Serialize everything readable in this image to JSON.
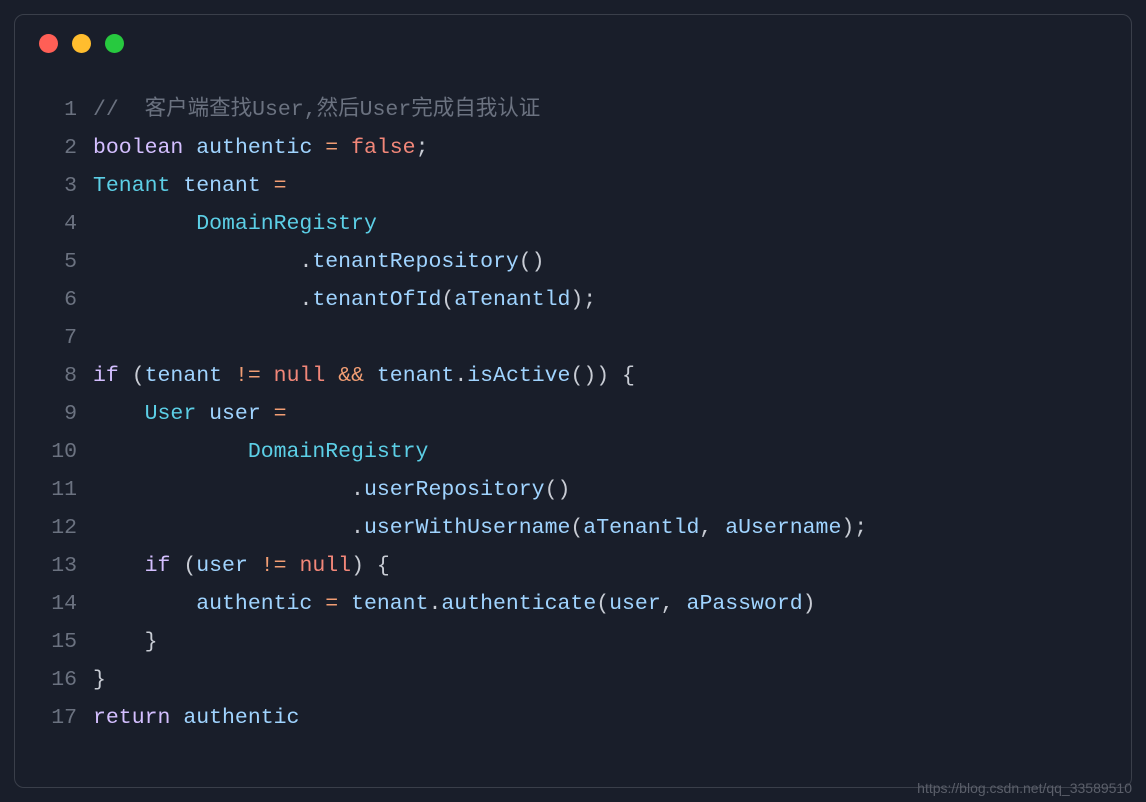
{
  "watermark": "https://blog.csdn.net/qq_33589510",
  "traffic_lights": {
    "red": "#ff5f56",
    "yellow": "#ffbd2e",
    "green": "#27c93f"
  },
  "code": {
    "lines": [
      {
        "n": 1,
        "tokens": [
          [
            "comment",
            "//  客户端查找User,然后User完成自我认证"
          ]
        ]
      },
      {
        "n": 2,
        "tokens": [
          [
            "keyword",
            "boolean"
          ],
          [
            "plain",
            " "
          ],
          [
            "ident",
            "authentic"
          ],
          [
            "plain",
            " "
          ],
          [
            "op",
            "="
          ],
          [
            "plain",
            " "
          ],
          [
            "const",
            "false"
          ],
          [
            "punct",
            ";"
          ]
        ]
      },
      {
        "n": 3,
        "tokens": [
          [
            "type",
            "Tenant"
          ],
          [
            "plain",
            " "
          ],
          [
            "ident",
            "tenant"
          ],
          [
            "plain",
            " "
          ],
          [
            "op",
            "="
          ]
        ]
      },
      {
        "n": 4,
        "tokens": [
          [
            "plain",
            "        "
          ],
          [
            "type",
            "DomainRegistry"
          ]
        ]
      },
      {
        "n": 5,
        "tokens": [
          [
            "plain",
            "                "
          ],
          [
            "punct",
            "."
          ],
          [
            "ident",
            "tenantRepository"
          ],
          [
            "punct",
            "()"
          ]
        ]
      },
      {
        "n": 6,
        "tokens": [
          [
            "plain",
            "                "
          ],
          [
            "punct",
            "."
          ],
          [
            "ident",
            "tenantOfId"
          ],
          [
            "punct",
            "("
          ],
          [
            "param",
            "aTenantld"
          ],
          [
            "punct",
            ");"
          ]
        ]
      },
      {
        "n": 7,
        "tokens": []
      },
      {
        "n": 8,
        "tokens": [
          [
            "keyword",
            "if"
          ],
          [
            "plain",
            " "
          ],
          [
            "punct",
            "("
          ],
          [
            "ident",
            "tenant"
          ],
          [
            "plain",
            " "
          ],
          [
            "op",
            "!="
          ],
          [
            "plain",
            " "
          ],
          [
            "const",
            "null"
          ],
          [
            "plain",
            " "
          ],
          [
            "op",
            "&&"
          ],
          [
            "plain",
            " "
          ],
          [
            "ident",
            "tenant"
          ],
          [
            "punct",
            "."
          ],
          [
            "ident",
            "isActive"
          ],
          [
            "punct",
            "()) {"
          ]
        ]
      },
      {
        "n": 9,
        "tokens": [
          [
            "plain",
            "    "
          ],
          [
            "type",
            "User"
          ],
          [
            "plain",
            " "
          ],
          [
            "ident",
            "user"
          ],
          [
            "plain",
            " "
          ],
          [
            "op",
            "="
          ]
        ]
      },
      {
        "n": 10,
        "tokens": [
          [
            "plain",
            "            "
          ],
          [
            "type",
            "DomainRegistry"
          ]
        ]
      },
      {
        "n": 11,
        "tokens": [
          [
            "plain",
            "                    "
          ],
          [
            "punct",
            "."
          ],
          [
            "ident",
            "userRepository"
          ],
          [
            "punct",
            "()"
          ]
        ]
      },
      {
        "n": 12,
        "tokens": [
          [
            "plain",
            "                    "
          ],
          [
            "punct",
            "."
          ],
          [
            "ident",
            "userWithUsername"
          ],
          [
            "punct",
            "("
          ],
          [
            "param",
            "aTenantld"
          ],
          [
            "punct",
            ", "
          ],
          [
            "param",
            "aUsername"
          ],
          [
            "punct",
            ");"
          ]
        ]
      },
      {
        "n": 13,
        "tokens": [
          [
            "plain",
            "    "
          ],
          [
            "keyword",
            "if"
          ],
          [
            "plain",
            " "
          ],
          [
            "punct",
            "("
          ],
          [
            "ident",
            "user"
          ],
          [
            "plain",
            " "
          ],
          [
            "op",
            "!="
          ],
          [
            "plain",
            " "
          ],
          [
            "const",
            "null"
          ],
          [
            "punct",
            ") {"
          ]
        ]
      },
      {
        "n": 14,
        "tokens": [
          [
            "plain",
            "        "
          ],
          [
            "ident",
            "authentic"
          ],
          [
            "plain",
            " "
          ],
          [
            "op",
            "="
          ],
          [
            "plain",
            " "
          ],
          [
            "ident",
            "tenant"
          ],
          [
            "punct",
            "."
          ],
          [
            "ident",
            "authenticate"
          ],
          [
            "punct",
            "("
          ],
          [
            "param",
            "user"
          ],
          [
            "punct",
            ", "
          ],
          [
            "param",
            "aPassword"
          ],
          [
            "punct",
            ")"
          ]
        ]
      },
      {
        "n": 15,
        "tokens": [
          [
            "plain",
            "    "
          ],
          [
            "punct",
            "}"
          ]
        ]
      },
      {
        "n": 16,
        "tokens": [
          [
            "punct",
            "}"
          ]
        ]
      },
      {
        "n": 17,
        "tokens": [
          [
            "keyword",
            "return"
          ],
          [
            "plain",
            " "
          ],
          [
            "ident",
            "authentic"
          ]
        ]
      }
    ]
  }
}
